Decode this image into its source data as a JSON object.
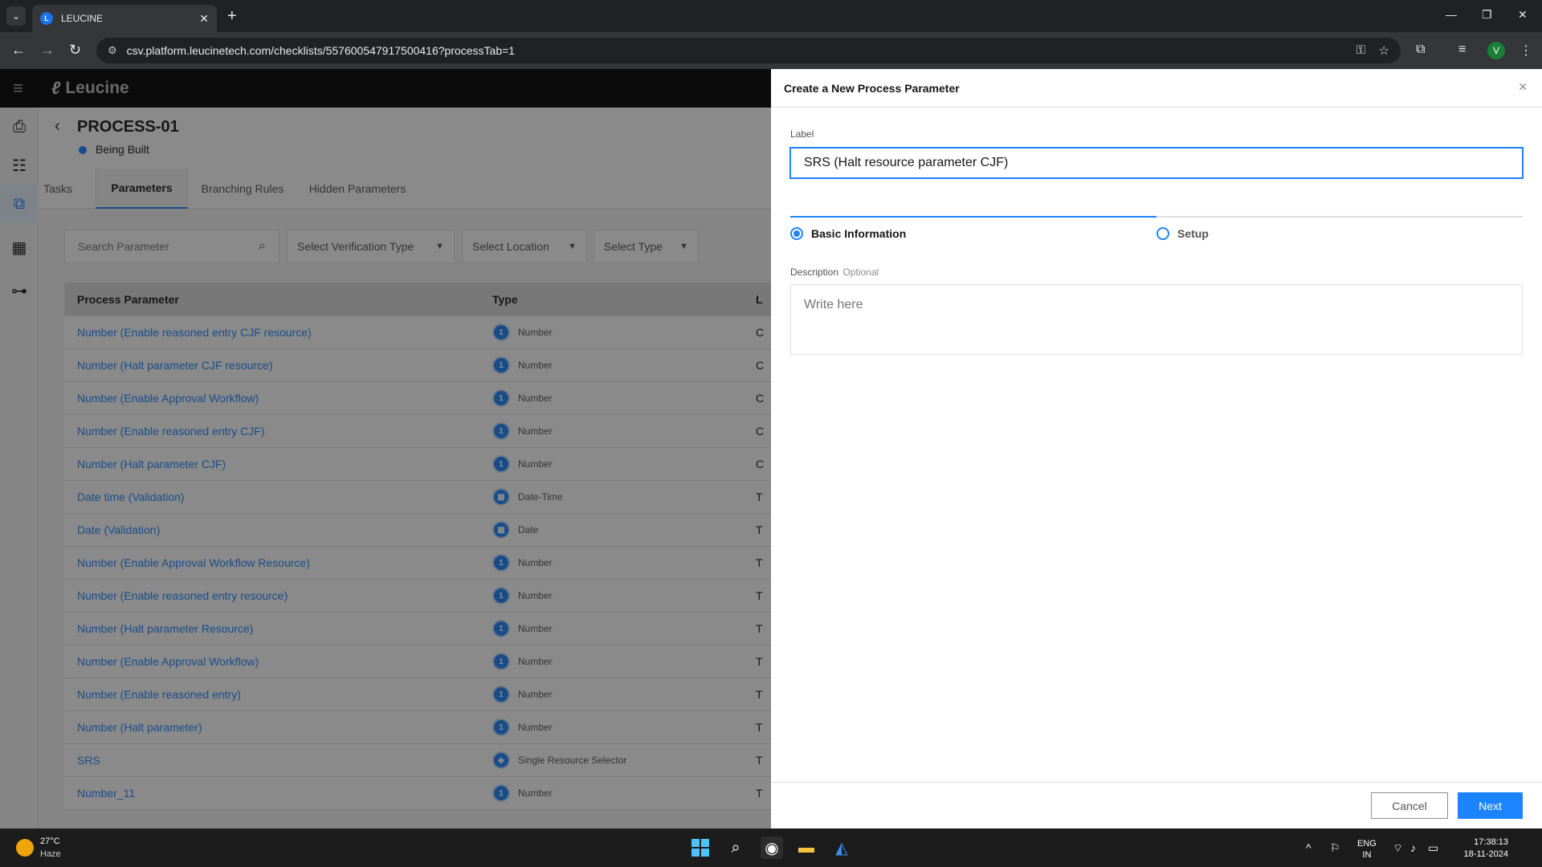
{
  "browser": {
    "tab_title": "LEUCINE",
    "url": "csv.platform.leucinetech.com/checklists/557600547917500416?processTab=1"
  },
  "app": {
    "brand": "Leucine"
  },
  "process": {
    "title": "PROCESS-01",
    "status": "Being Built"
  },
  "tabs": [
    {
      "label": "Tasks"
    },
    {
      "label": "Parameters"
    },
    {
      "label": "Branching Rules"
    },
    {
      "label": "Hidden Parameters"
    }
  ],
  "filters": {
    "search_placeholder": "Search Parameter",
    "verification_type": "Select Verification Type",
    "location": "Select Location",
    "type": "Select Type"
  },
  "table": {
    "headers": {
      "name": "Process Parameter",
      "type": "Type",
      "third": "L"
    },
    "rows": [
      {
        "name": "Number (Enable reasoned entry CJF resource)",
        "type": "Number",
        "third": "C"
      },
      {
        "name": "Number (Halt parameter CJF resource)",
        "type": "Number",
        "third": "C"
      },
      {
        "name": "Number (Enable Approval Workflow)",
        "type": "Number",
        "third": "C"
      },
      {
        "name": "Number (Enable reasoned entry CJF)",
        "type": "Number",
        "third": "C"
      },
      {
        "name": "Number (Halt parameter CJF)",
        "type": "Number",
        "third": "C"
      },
      {
        "name": "Date time (Validation)",
        "type": "Date-Time",
        "third": "T"
      },
      {
        "name": "Date (Validation)",
        "type": "Date",
        "third": "T"
      },
      {
        "name": "Number (Enable Approval Workflow Resource)",
        "type": "Number",
        "third": "T"
      },
      {
        "name": "Number (Enable reasoned entry resource)",
        "type": "Number",
        "third": "T"
      },
      {
        "name": "Number (Halt parameter Resource)",
        "type": "Number",
        "third": "T"
      },
      {
        "name": "Number (Enable Approval Workflow)",
        "type": "Number",
        "third": "T"
      },
      {
        "name": "Number (Enable reasoned entry)",
        "type": "Number",
        "third": "T"
      },
      {
        "name": "Number (Halt parameter)",
        "type": "Number",
        "third": "T"
      },
      {
        "name": "SRS",
        "type": "Single Resource Selector",
        "third": "T"
      },
      {
        "name": "Number_11",
        "type": "Number",
        "third": "T"
      }
    ]
  },
  "drawer": {
    "title": "Create a New Process Parameter",
    "label_caption": "Label",
    "label_value": "SRS (Halt resource parameter CJF)",
    "steps": [
      {
        "label": "Basic Information"
      },
      {
        "label": "Setup"
      }
    ],
    "description_caption": "Description",
    "description_optional": "Optional",
    "description_placeholder": "Write here",
    "cancel_label": "Cancel",
    "next_label": "Next"
  },
  "taskbar": {
    "temperature": "27°C",
    "weather": "Haze",
    "lang_top": "ENG",
    "lang_bottom": "IN",
    "time": "17:38:13",
    "date": "18-11-2024"
  },
  "colors": {
    "accent": "#1d84ff",
    "header_bg": "#000000"
  }
}
